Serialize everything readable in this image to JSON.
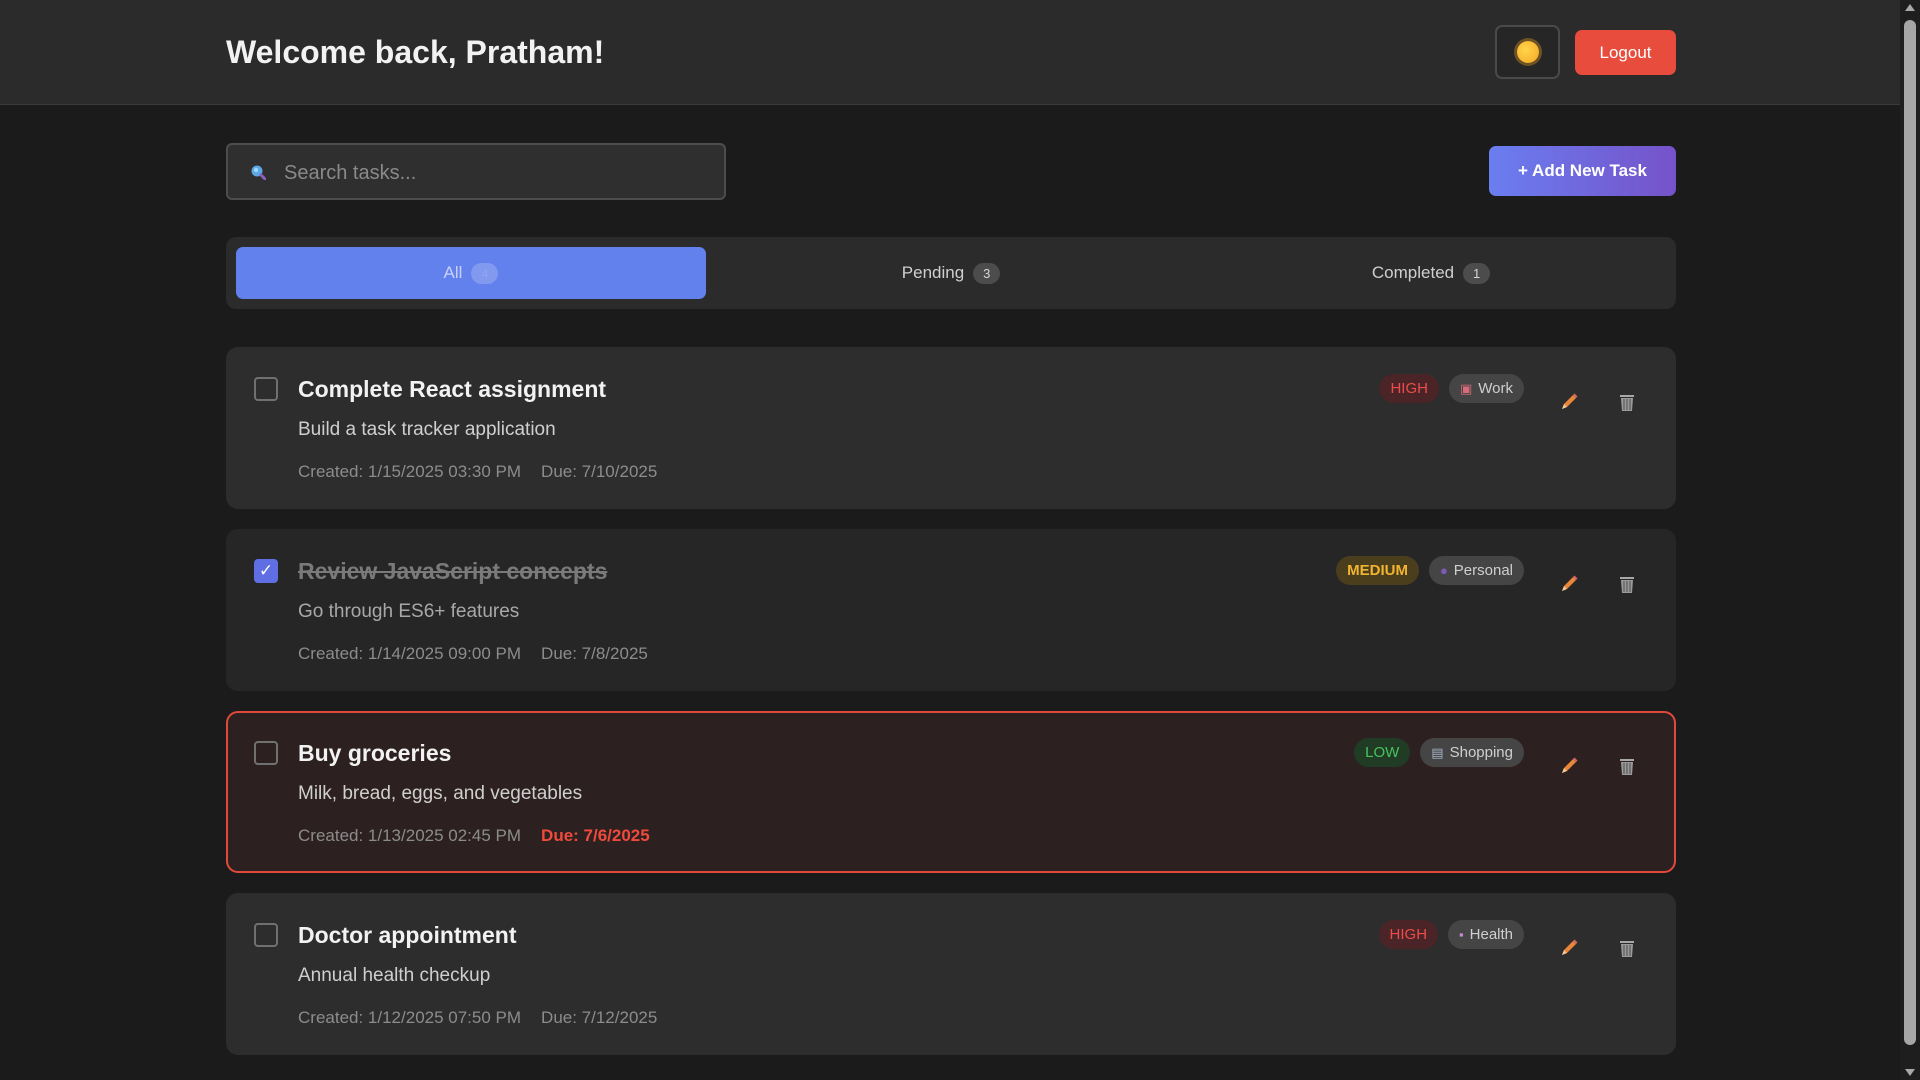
{
  "header": {
    "welcome": "Welcome back, Pratham!",
    "theme_icon": "sun-icon",
    "logout_label": "Logout"
  },
  "search": {
    "placeholder": "Search tasks...",
    "icon": "search-icon"
  },
  "add_task_label": "+ Add New Task",
  "tabs": [
    {
      "label": "All",
      "count": "4",
      "active": true
    },
    {
      "label": "Pending",
      "count": "3",
      "active": false
    },
    {
      "label": "Completed",
      "count": "1",
      "active": false
    }
  ],
  "tasks": [
    {
      "title": "Complete React assignment",
      "description": "Build a task tracker application",
      "created": "Created: 1/15/2025 03:30 PM",
      "due": "Due: 7/10/2025",
      "priority": "HIGH",
      "category": "Work",
      "category_icon": "briefcase-icon",
      "completed": false,
      "overdue": false
    },
    {
      "title": "Review JavaScript concepts",
      "description": "Go through ES6+ features",
      "created": "Created: 1/14/2025 09:00 PM",
      "due": "Due: 7/8/2025",
      "priority": "MEDIUM",
      "category": "Personal",
      "category_icon": "person-icon",
      "completed": true,
      "overdue": false
    },
    {
      "title": "Buy groceries",
      "description": "Milk, bread, eggs, and vegetables",
      "created": "Created: 1/13/2025 02:45 PM",
      "due": "Due: 7/6/2025",
      "priority": "LOW",
      "category": "Shopping",
      "category_icon": "shopping-cart-icon",
      "completed": false,
      "overdue": true
    },
    {
      "title": "Doctor appointment",
      "description": "Annual health checkup",
      "created": "Created: 1/12/2025 07:50 PM",
      "due": "Due: 7/12/2025",
      "priority": "HIGH",
      "category": "Health",
      "category_icon": "medical-icon",
      "completed": false,
      "overdue": false
    }
  ],
  "colors": {
    "accent": "#6381ec",
    "danger": "#e74c3c",
    "high": "#ee4c4c",
    "medium": "#f2b531",
    "low": "#49c25d"
  }
}
